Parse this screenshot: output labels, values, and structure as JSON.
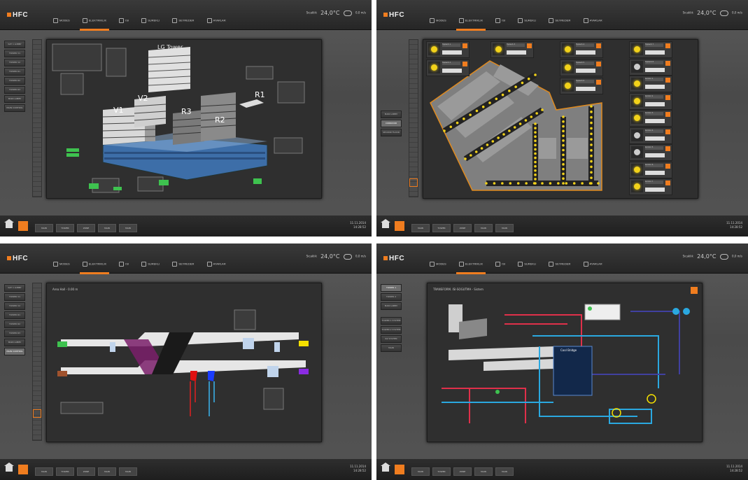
{
  "app": {
    "logo_text": "HFC",
    "nav": [
      {
        "label": "MODES",
        "icon": "bulb-icon"
      },
      {
        "label": "ELEKTRIKLIK",
        "icon": "plug-icon"
      },
      {
        "label": "ISI",
        "icon": "fan-icon"
      },
      {
        "label": "SUREKLI",
        "icon": "factory-icon"
      },
      {
        "label": "SEYREDER",
        "icon": "eye-icon"
      },
      {
        "label": "AYARLAR",
        "icon": "settings-icon"
      }
    ],
    "weather_label": "Sıcaklık",
    "accent_color": "#f07d1f"
  },
  "panels": [
    {
      "temperature": "24,0°C",
      "wind": "0,0 m/s",
      "active_nav": 1,
      "sidebar": [
        "KAT 1 LOBBY",
        "TOWER V1",
        "TOWER V2",
        "TOWER R1",
        "TOWER R2",
        "TOWER R3",
        "MAIN LOBBY",
        "MAIN CONTROL"
      ],
      "screen_title": "",
      "labels": {
        "tower": "LG Tower",
        "v1": "V1",
        "v2": "V2",
        "r1": "R1",
        "r2": "R2",
        "r3": "R3"
      },
      "tasks": [
        "MAIN",
        "TOWER",
        "ZONE",
        "MAIN",
        "MAIN"
      ],
      "clock": [
        "11.11.2014",
        "14:28:52"
      ]
    },
    {
      "temperature": "24,0°C",
      "wind": "0,0 m/s",
      "active_nav": 1,
      "sidebar": [
        "MAIN LOBBY",
        "CORRIDOR",
        "SECOND FLOOR"
      ],
      "tasks": [
        "MAIN",
        "TOWER",
        "ZONE",
        "MAIN",
        "MAIN"
      ],
      "clock": [
        "11.11.2014",
        "14:28:52"
      ],
      "bulbs": [
        {
          "name": "Toplantı 1",
          "on": true
        },
        {
          "name": "Toplantı 2",
          "on": true
        },
        {
          "name": "Toplantı 3",
          "on": true
        },
        {
          "name": "Toplantı 4",
          "on": true
        },
        {
          "name": "Toplantı 5",
          "on": true
        },
        {
          "name": "Toplantı 6",
          "on": true
        },
        {
          "name": "Toplantı 7",
          "on": true
        },
        {
          "name": "Toplantı 8",
          "on": false
        },
        {
          "name": "Koridor 1",
          "on": true
        },
        {
          "name": "Koridor 2",
          "on": true
        },
        {
          "name": "Koridor 3",
          "on": true
        },
        {
          "name": "Koridor 4",
          "on": false
        },
        {
          "name": "Koridor 5",
          "on": false
        },
        {
          "name": "Koridor 6",
          "on": true
        },
        {
          "name": "Koridor 7",
          "on": true
        }
      ]
    },
    {
      "temperature": "24,0°C",
      "wind": "0,0 m/s",
      "active_nav": 1,
      "sidebar": [
        "KAT 1 LOBBY",
        "TOWER V1",
        "TOWER V2",
        "TOWER R1",
        "TOWER R2",
        "TOWER R3",
        "MAIN LOBBY",
        "MAIN CONTROL"
      ],
      "screen_title": "Area Hall - 0.00 m",
      "tasks": [
        "MAIN",
        "TOWER",
        "ZONE",
        "MAIN",
        "MAIN"
      ],
      "clock": [
        "11.11.2014",
        "14:28:52"
      ]
    },
    {
      "temperature": "24,0°C",
      "wind": "0,0 m/s",
      "active_nav": 1,
      "sidebar": [
        "TOWER 1",
        "TOWER 2",
        "MAIN LOBBY",
        "TOWER 1 SYSTEM",
        "TOWER 2 SYSTEM",
        "R2 SYSTEM",
        "MAIN"
      ],
      "screen_title": "TRANSFORM. ISI-SOGUTMA - Sistem",
      "overlay_title": "Cool Bridge",
      "tasks": [
        "MAIN",
        "TOWER",
        "ZONE",
        "MAIN",
        "MAIN"
      ],
      "clock": [
        "11.11.2014",
        "14:28:52"
      ]
    }
  ]
}
